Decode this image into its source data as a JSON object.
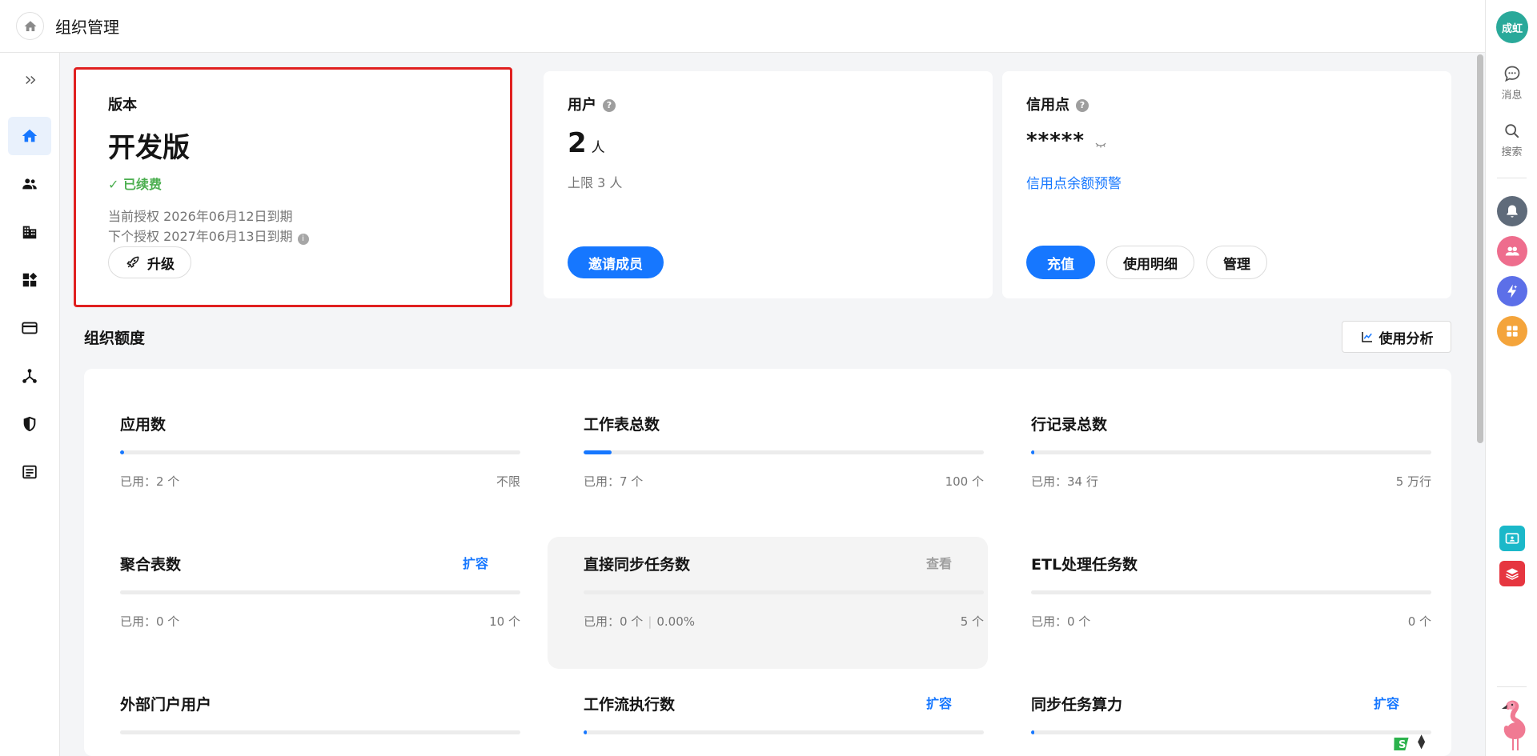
{
  "header": {
    "title": "组织管理"
  },
  "user": {
    "avatar_text": "成虹"
  },
  "rightbar": {
    "messages_label": "消息",
    "search_label": "搜索"
  },
  "version_card": {
    "label": "版本",
    "edition": "开发版",
    "status": "已续费",
    "current_license": "当前授权 2026年06月12日到期",
    "next_license": "下个授权 2027年06月13日到期",
    "upgrade_label": "升级"
  },
  "users_card": {
    "label": "用户",
    "count": "2",
    "unit": "人",
    "limit": "上限 3 人",
    "invite_label": "邀请成员"
  },
  "credit_card": {
    "label": "信用点",
    "masked_value": "*****",
    "alert_link": "信用点余额预警",
    "recharge_label": "充值",
    "details_label": "使用明细",
    "manage_label": "管理"
  },
  "quota_section": {
    "title": "组织额度",
    "analysis_label": "使用分析",
    "items": [
      {
        "title": "应用数",
        "action": "",
        "used": "已用：2 个",
        "extra": "",
        "limit": "不限",
        "fill": 0.01
      },
      {
        "title": "工作表总数",
        "action": "",
        "used": "已用：7 个",
        "extra": "",
        "limit": "100 个",
        "fill": 0.07
      },
      {
        "title": "行记录总数",
        "action": "",
        "used": "已用：34 行",
        "extra": "",
        "limit": "5 万行",
        "fill": 0.0007
      },
      {
        "title": "聚合表数",
        "action": "扩容",
        "used": "已用：0 个",
        "extra": "",
        "limit": "10 个",
        "fill": 0
      },
      {
        "title": "直接同步任务数",
        "action": "查看",
        "used": "已用：0 个",
        "extra": "0.00%",
        "limit": "5 个",
        "fill": 0
      },
      {
        "title": "ETL处理任务数",
        "action": "",
        "used": "已用：0 个",
        "extra": "",
        "limit": "0 个",
        "fill": 0
      },
      {
        "title": "外部门户用户",
        "action": "",
        "used": "",
        "extra": "",
        "limit": "",
        "fill": 0
      },
      {
        "title": "工作流执行数",
        "action": "扩容",
        "used": "",
        "extra": "",
        "limit": "",
        "fill": 0.002
      },
      {
        "title": "同步任务算力",
        "action": "扩容",
        "used": "",
        "extra": "",
        "limit": "",
        "fill": 0.001
      }
    ]
  },
  "colors": {
    "primary": "#1677ff",
    "success": "#4caf50",
    "highlight_border": "#e02020"
  }
}
